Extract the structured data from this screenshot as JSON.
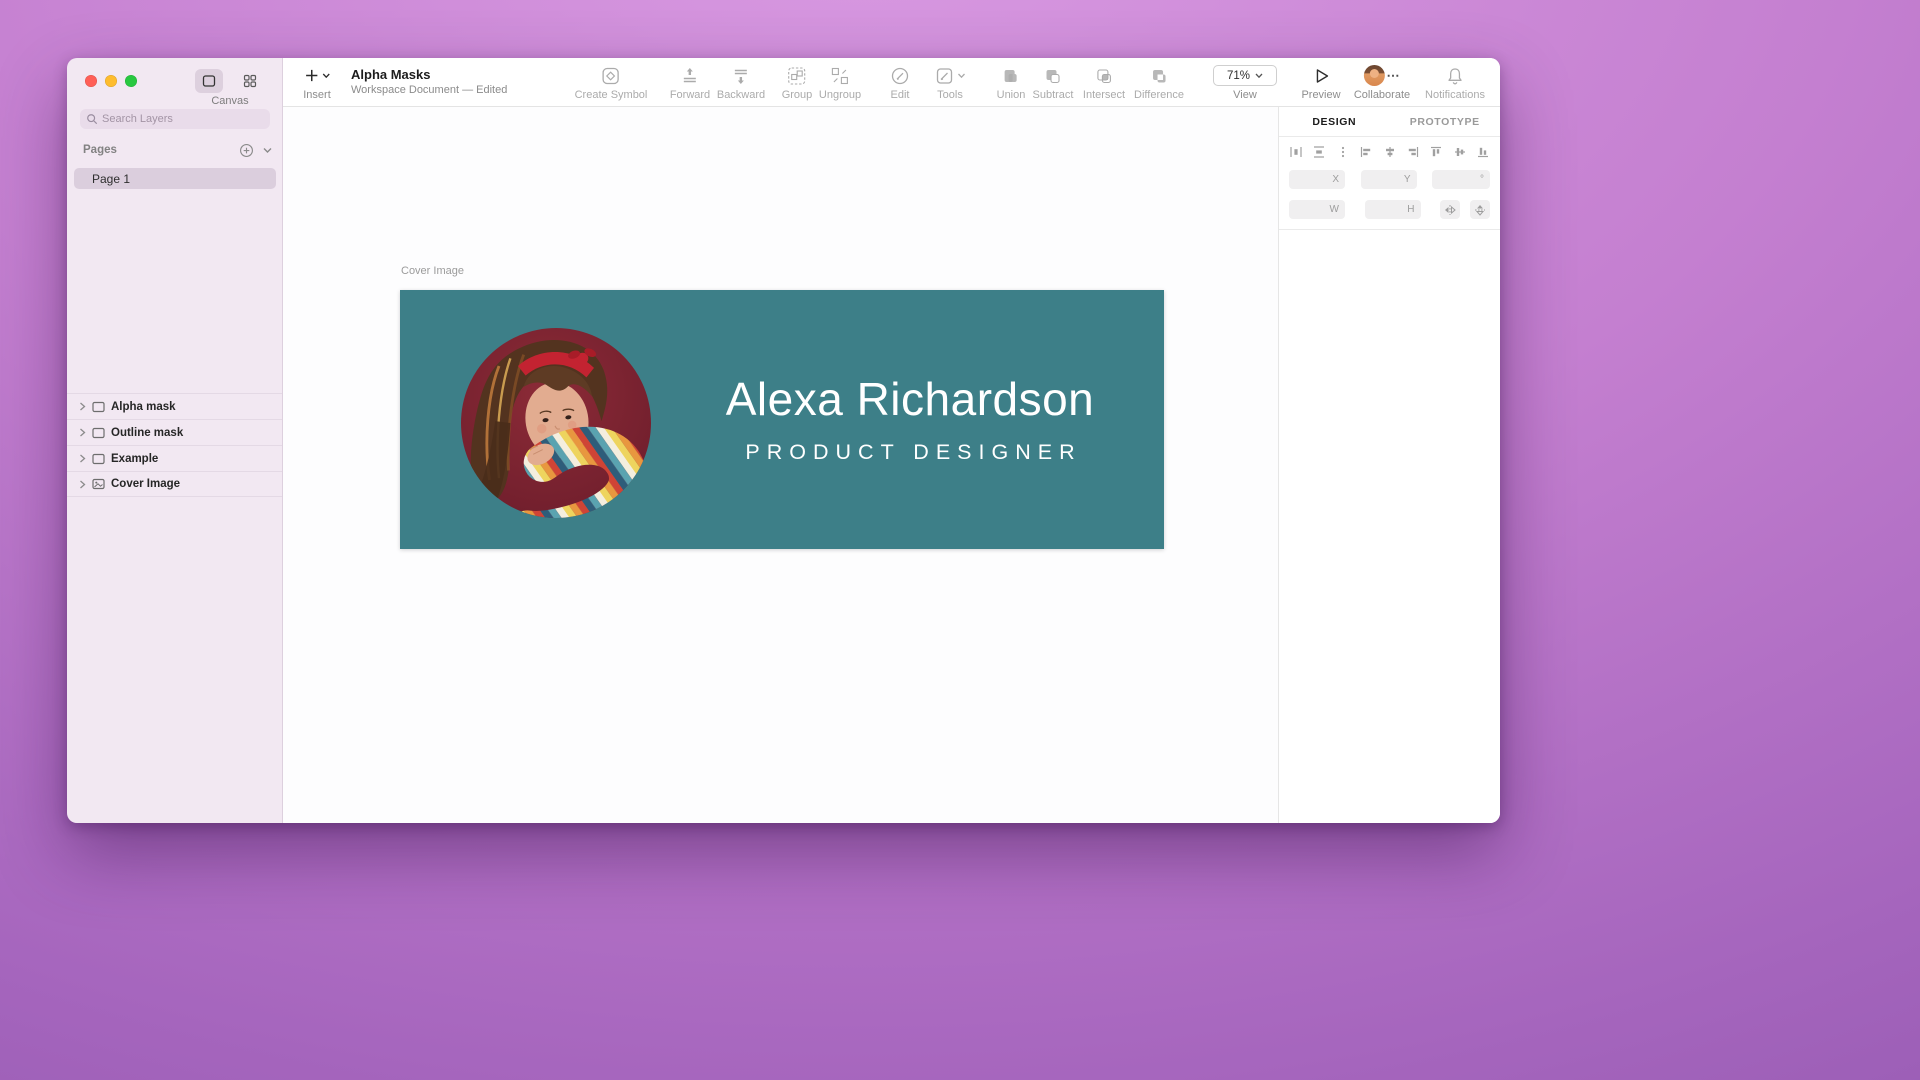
{
  "colors": {
    "artboard": "#3d7f88"
  },
  "sidebar": {
    "canvas_label": "Canvas",
    "search_placeholder": "Search Layers",
    "pages_label": "Pages",
    "pages": [
      {
        "label": "Page 1"
      }
    ],
    "layers": [
      {
        "label": "Alpha mask"
      },
      {
        "label": "Outline mask"
      },
      {
        "label": "Example"
      },
      {
        "label": "Cover Image"
      }
    ]
  },
  "toolbar": {
    "insert": "Insert",
    "doc_title": "Alpha Masks",
    "doc_subtitle": "Workspace Document — Edited",
    "create_symbol": "Create Symbol",
    "forward": "Forward",
    "backward": "Backward",
    "group": "Group",
    "ungroup": "Ungroup",
    "edit": "Edit",
    "tools": "Tools",
    "union": "Union",
    "subtract": "Subtract",
    "intersect": "Intersect",
    "difference": "Difference",
    "zoom": "71%",
    "view": "View",
    "preview": "Preview",
    "collaborate": "Collaborate",
    "notifications": "Notifications"
  },
  "inspector": {
    "tab_design": "DESIGN",
    "tab_prototype": "PROTOTYPE",
    "field_x": "X",
    "field_y": "Y",
    "field_rotation": "°",
    "field_w": "W",
    "field_h": "H"
  },
  "canvas": {
    "artboard_label": "Cover Image",
    "name": "Alexa Richardson",
    "role": "PRODUCT DESIGNER"
  }
}
